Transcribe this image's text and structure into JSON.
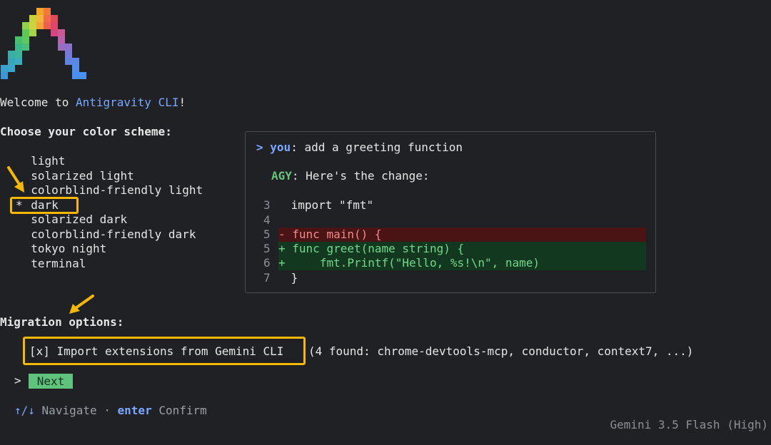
{
  "welcome": {
    "prefix": "Welcome to ",
    "app_name": "Antigravity CLI",
    "suffix": "!"
  },
  "color_scheme": {
    "heading": "Choose your color scheme:",
    "selected_marker": "*",
    "options": [
      "light",
      "solarized light",
      "colorblind-friendly light",
      "dark",
      "solarized dark",
      "colorblind-friendly dark",
      "tokyo night",
      "terminal"
    ],
    "selected_index": 3
  },
  "preview": {
    "prompt_marker": ">",
    "you_label": "you",
    "you_message": ": add a greeting function",
    "agy_label": "AGY",
    "agy_message": ": Here's the change:",
    "diff": [
      {
        "line": "3",
        "marker": " ",
        "code": "import \"fmt\"",
        "kind": "context"
      },
      {
        "line": "4",
        "marker": " ",
        "code": "",
        "kind": "context"
      },
      {
        "line": "5",
        "marker": "-",
        "code": "func main() {",
        "kind": "del"
      },
      {
        "line": "5",
        "marker": "+",
        "code": "func greet(name string) {",
        "kind": "add"
      },
      {
        "line": "6",
        "marker": "+",
        "code": "    fmt.Printf(\"Hello, %s!\\n\", name)",
        "kind": "add"
      },
      {
        "line": "7",
        "marker": " ",
        "code": "}",
        "kind": "context"
      }
    ]
  },
  "migration": {
    "heading": "Migration options:",
    "option_label": "[x] Import extensions from Gemini CLI",
    "option_detail": "(4 found: chrome-devtools-mcp, conductor, context7, ...)"
  },
  "next": {
    "marker": ">",
    "label": "Next"
  },
  "footer": {
    "nav_keys": "↑/↓",
    "nav_label": "Navigate",
    "separator": "·",
    "confirm_key": "enter",
    "confirm_label": "Confirm",
    "model": "Gemini 3.5 Flash (High)"
  },
  "colors": {
    "background": "#1f2125",
    "accent_blue": "#7aa7ff",
    "accent_green": "#66c57a",
    "highlight_yellow": "#f6b800",
    "diff_del_bg": "#4b1414",
    "diff_add_bg": "#12391f"
  }
}
